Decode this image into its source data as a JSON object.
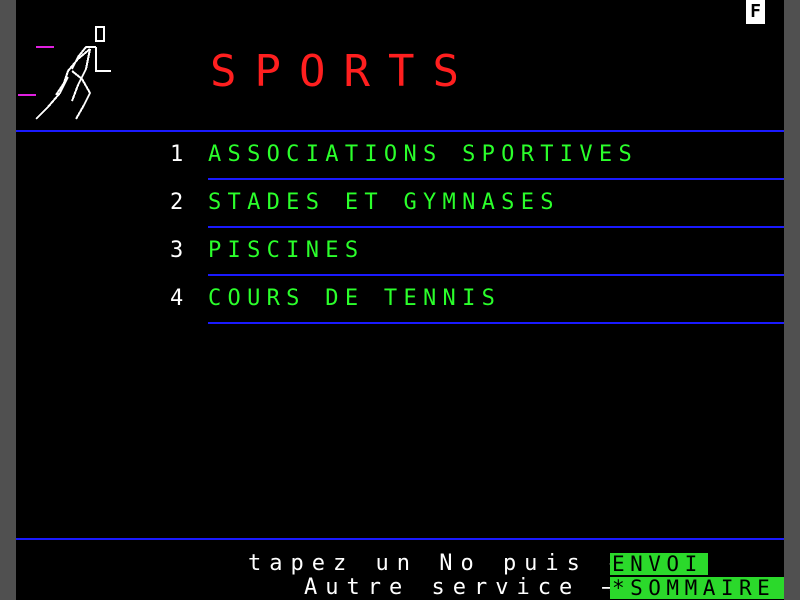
{
  "header": {
    "mode_badge": "F",
    "title": "SPORTS",
    "illustration": "runner-icon"
  },
  "menu": {
    "items": [
      {
        "number": "1",
        "label": "ASSOCIATIONS SPORTIVES"
      },
      {
        "number": "2",
        "label": "STADES ET GYMNASES"
      },
      {
        "number": "3",
        "label": "PISCINES"
      },
      {
        "number": "4",
        "label": "COURS DE TENNIS"
      }
    ]
  },
  "footer": {
    "line1_text": "tapez un No puis →",
    "line1_key": "ENVOI",
    "line2_text": "Autre service →",
    "line2_key": "*SOMMAIRE"
  },
  "colors": {
    "background": "#000000",
    "title": "#ff1f1f",
    "menu_text": "#2bff2b",
    "rules": "#1a1aff",
    "key_bg": "#2bd92b"
  }
}
